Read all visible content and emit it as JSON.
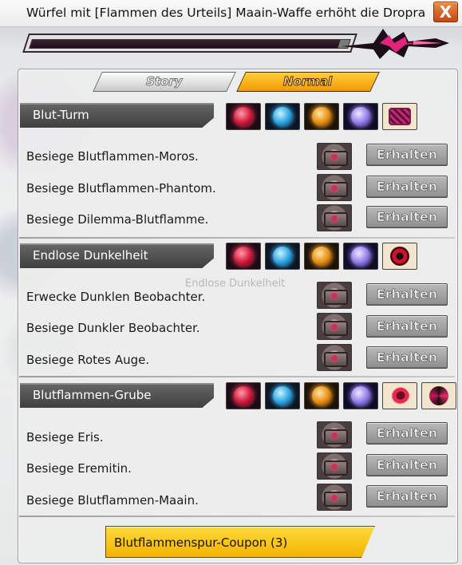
{
  "title": "Würfel mit [Flammen des Urteils] Maain-Waffe erhöht die Dropra",
  "close_label": "X",
  "progress": {
    "fraction": 0.97
  },
  "tabs": {
    "story": "Story",
    "normal": "Normal",
    "active": "Normal"
  },
  "sections": [
    {
      "name": "Blut-Turm",
      "rewards": [
        "red-gem-icon",
        "blue-gem-icon",
        "orange-gem-icon",
        "purple-gem-icon",
        "pink-crest-icon"
      ],
      "quests": [
        {
          "text": "Besiege Blutflammen-Moros.",
          "button": "Erhalten"
        },
        {
          "text": "Besiege Blutflammen-Phantom.",
          "button": "Erhalten"
        },
        {
          "text": "Besiege Dilemma-Blutflamme.",
          "button": "Erhalten"
        }
      ]
    },
    {
      "name": "Endlose Dunkelheit",
      "rewards": [
        "red-gem-icon",
        "blue-gem-icon",
        "orange-gem-icon",
        "purple-gem-icon",
        "red-eye-icon"
      ],
      "quests": [
        {
          "text": "Erwecke Dunklen Beobachter.",
          "button": "Erhalten"
        },
        {
          "text": "Besiege Dunkler Beobachter.",
          "button": "Erhalten"
        },
        {
          "text": "Besiege Rotes Auge.",
          "button": "Erhalten"
        }
      ]
    },
    {
      "name": "Blutflammen-Grube",
      "rewards": [
        "red-gem-icon",
        "blue-gem-icon",
        "orange-gem-icon",
        "purple-gem-icon",
        "blood-eye-icon",
        "dark-mask-icon"
      ],
      "quests": [
        {
          "text": "Besiege Eris.",
          "button": "Erhalten"
        },
        {
          "text": "Besiege Eremitin.",
          "button": "Erhalten"
        },
        {
          "text": "Besiege Blutflammen-Maain.",
          "button": "Erhalten"
        }
      ]
    }
  ],
  "background_labels": {
    "endlose": "Endlose Dunkelheit"
  },
  "coupon_button": "Blutflammenspur-Coupon (3)"
}
